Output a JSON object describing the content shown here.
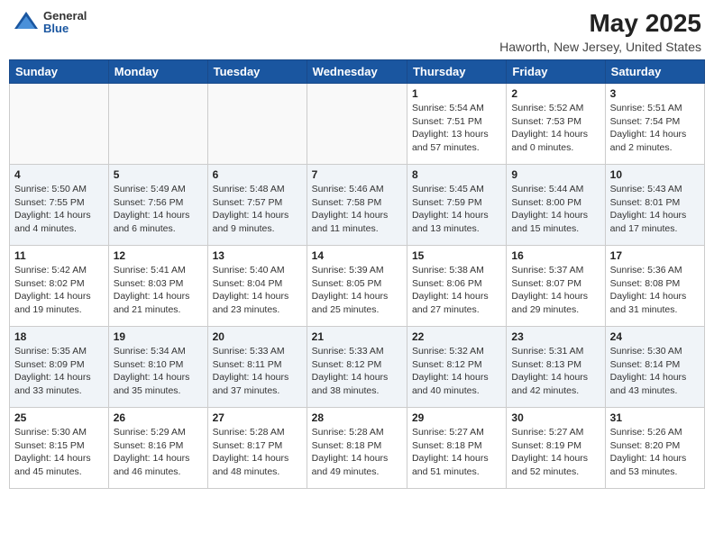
{
  "header": {
    "logo_general": "General",
    "logo_blue": "Blue",
    "month_year": "May 2025",
    "location": "Haworth, New Jersey, United States"
  },
  "days_of_week": [
    "Sunday",
    "Monday",
    "Tuesday",
    "Wednesday",
    "Thursday",
    "Friday",
    "Saturday"
  ],
  "weeks": [
    [
      {
        "day": "",
        "content": ""
      },
      {
        "day": "",
        "content": ""
      },
      {
        "day": "",
        "content": ""
      },
      {
        "day": "",
        "content": ""
      },
      {
        "day": "1",
        "content": "Sunrise: 5:54 AM\nSunset: 7:51 PM\nDaylight: 13 hours\nand 57 minutes."
      },
      {
        "day": "2",
        "content": "Sunrise: 5:52 AM\nSunset: 7:53 PM\nDaylight: 14 hours\nand 0 minutes."
      },
      {
        "day": "3",
        "content": "Sunrise: 5:51 AM\nSunset: 7:54 PM\nDaylight: 14 hours\nand 2 minutes."
      }
    ],
    [
      {
        "day": "4",
        "content": "Sunrise: 5:50 AM\nSunset: 7:55 PM\nDaylight: 14 hours\nand 4 minutes."
      },
      {
        "day": "5",
        "content": "Sunrise: 5:49 AM\nSunset: 7:56 PM\nDaylight: 14 hours\nand 6 minutes."
      },
      {
        "day": "6",
        "content": "Sunrise: 5:48 AM\nSunset: 7:57 PM\nDaylight: 14 hours\nand 9 minutes."
      },
      {
        "day": "7",
        "content": "Sunrise: 5:46 AM\nSunset: 7:58 PM\nDaylight: 14 hours\nand 11 minutes."
      },
      {
        "day": "8",
        "content": "Sunrise: 5:45 AM\nSunset: 7:59 PM\nDaylight: 14 hours\nand 13 minutes."
      },
      {
        "day": "9",
        "content": "Sunrise: 5:44 AM\nSunset: 8:00 PM\nDaylight: 14 hours\nand 15 minutes."
      },
      {
        "day": "10",
        "content": "Sunrise: 5:43 AM\nSunset: 8:01 PM\nDaylight: 14 hours\nand 17 minutes."
      }
    ],
    [
      {
        "day": "11",
        "content": "Sunrise: 5:42 AM\nSunset: 8:02 PM\nDaylight: 14 hours\nand 19 minutes."
      },
      {
        "day": "12",
        "content": "Sunrise: 5:41 AM\nSunset: 8:03 PM\nDaylight: 14 hours\nand 21 minutes."
      },
      {
        "day": "13",
        "content": "Sunrise: 5:40 AM\nSunset: 8:04 PM\nDaylight: 14 hours\nand 23 minutes."
      },
      {
        "day": "14",
        "content": "Sunrise: 5:39 AM\nSunset: 8:05 PM\nDaylight: 14 hours\nand 25 minutes."
      },
      {
        "day": "15",
        "content": "Sunrise: 5:38 AM\nSunset: 8:06 PM\nDaylight: 14 hours\nand 27 minutes."
      },
      {
        "day": "16",
        "content": "Sunrise: 5:37 AM\nSunset: 8:07 PM\nDaylight: 14 hours\nand 29 minutes."
      },
      {
        "day": "17",
        "content": "Sunrise: 5:36 AM\nSunset: 8:08 PM\nDaylight: 14 hours\nand 31 minutes."
      }
    ],
    [
      {
        "day": "18",
        "content": "Sunrise: 5:35 AM\nSunset: 8:09 PM\nDaylight: 14 hours\nand 33 minutes."
      },
      {
        "day": "19",
        "content": "Sunrise: 5:34 AM\nSunset: 8:10 PM\nDaylight: 14 hours\nand 35 minutes."
      },
      {
        "day": "20",
        "content": "Sunrise: 5:33 AM\nSunset: 8:11 PM\nDaylight: 14 hours\nand 37 minutes."
      },
      {
        "day": "21",
        "content": "Sunrise: 5:33 AM\nSunset: 8:12 PM\nDaylight: 14 hours\nand 38 minutes."
      },
      {
        "day": "22",
        "content": "Sunrise: 5:32 AM\nSunset: 8:12 PM\nDaylight: 14 hours\nand 40 minutes."
      },
      {
        "day": "23",
        "content": "Sunrise: 5:31 AM\nSunset: 8:13 PM\nDaylight: 14 hours\nand 42 minutes."
      },
      {
        "day": "24",
        "content": "Sunrise: 5:30 AM\nSunset: 8:14 PM\nDaylight: 14 hours\nand 43 minutes."
      }
    ],
    [
      {
        "day": "25",
        "content": "Sunrise: 5:30 AM\nSunset: 8:15 PM\nDaylight: 14 hours\nand 45 minutes."
      },
      {
        "day": "26",
        "content": "Sunrise: 5:29 AM\nSunset: 8:16 PM\nDaylight: 14 hours\nand 46 minutes."
      },
      {
        "day": "27",
        "content": "Sunrise: 5:28 AM\nSunset: 8:17 PM\nDaylight: 14 hours\nand 48 minutes."
      },
      {
        "day": "28",
        "content": "Sunrise: 5:28 AM\nSunset: 8:18 PM\nDaylight: 14 hours\nand 49 minutes."
      },
      {
        "day": "29",
        "content": "Sunrise: 5:27 AM\nSunset: 8:18 PM\nDaylight: 14 hours\nand 51 minutes."
      },
      {
        "day": "30",
        "content": "Sunrise: 5:27 AM\nSunset: 8:19 PM\nDaylight: 14 hours\nand 52 minutes."
      },
      {
        "day": "31",
        "content": "Sunrise: 5:26 AM\nSunset: 8:20 PM\nDaylight: 14 hours\nand 53 minutes."
      }
    ]
  ]
}
